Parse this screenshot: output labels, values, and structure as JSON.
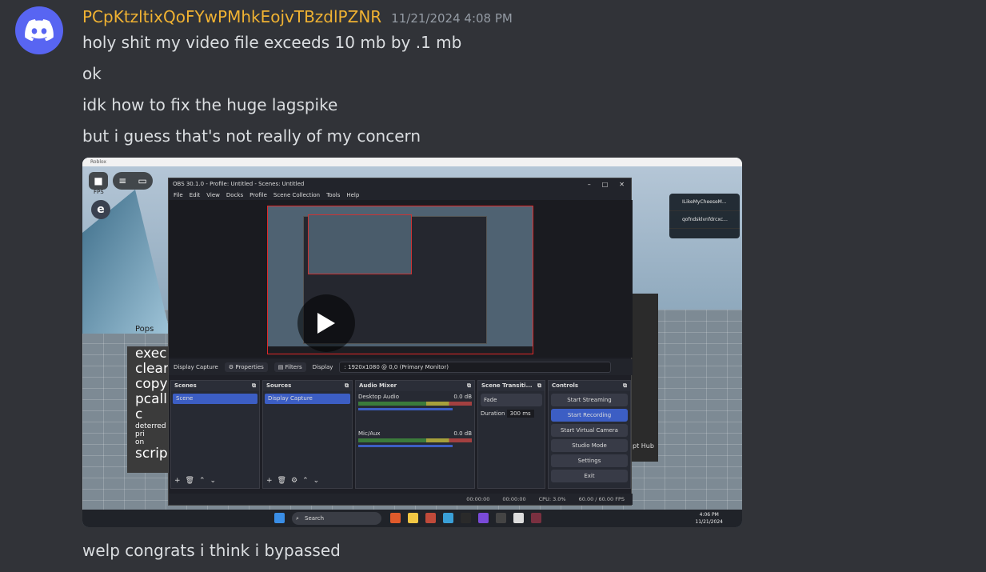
{
  "message": {
    "username": "PCpKtzltixQoFYwPMhkEojvTBzdlPZNR",
    "timestamp": "11/21/2024 4:08 PM",
    "lines": [
      "holy shit my video file exceeds 10 mb by .1 mb",
      "ok",
      "idk how to fix the huge lagspike",
      "but i guess that's not really of my concern"
    ],
    "after_video": "welp congrats i think i bypassed"
  },
  "video": {
    "roblox": {
      "window_title": "Roblox",
      "fps_label": "FPS",
      "pops_label": "Pops",
      "exec_panel": [
        "exec",
        "clear",
        "copy",
        "pcall: c",
        "deterred pri",
        "on",
        "script"
      ],
      "notifications": [
        "ILikeMyCheeseM...",
        "qofndsklvnfdrcxc..."
      ],
      "hub_label": "pt Hub"
    },
    "obs": {
      "title": "OBS 30.1.0 - Profile: Untitled - Scenes: Untitled",
      "menu": [
        "File",
        "Edit",
        "View",
        "Docks",
        "Profile",
        "Scene Collection",
        "Tools",
        "Help"
      ],
      "source_bar": {
        "source": "Display Capture",
        "properties": "Properties",
        "filters": "Filters",
        "display_label": "Display",
        "display_value": ": 1920x1080 @ 0,0 (Primary Monitor)"
      },
      "docks": {
        "scenes": {
          "title": "Scenes",
          "item": "Scene"
        },
        "sources": {
          "title": "Sources",
          "item": "Display Capture"
        },
        "mixer": {
          "title": "Audio Mixer",
          "channels": [
            {
              "name": "Desktop Audio",
              "db": "0.0 dB"
            },
            {
              "name": "Mic/Aux",
              "db": "0.0 dB"
            }
          ]
        },
        "transitions": {
          "title": "Scene Transiti...",
          "type": "Fade",
          "duration_label": "Duration",
          "duration_value": "300 ms"
        },
        "controls": {
          "title": "Controls",
          "buttons": [
            "Start Streaming",
            "Start Recording",
            "Start Virtual Camera",
            "Studio Mode",
            "Settings",
            "Exit"
          ]
        }
      },
      "status": {
        "stream_time": "00:00:00",
        "rec_time": "00:00:00",
        "cpu": "CPU: 3.0%",
        "fps": "60.00 / 60.00 FPS"
      }
    },
    "taskbar": {
      "search_placeholder": "Search",
      "time": "4:06 PM",
      "date": "11/21/2024"
    }
  },
  "colors": {
    "background": "#313338",
    "username": "#f0b232",
    "timestamp": "#949ba4",
    "text": "#dbdee1",
    "blurple": "#5865f2",
    "obs_accent": "#3c5ec4"
  },
  "icons": [
    "discord-icon",
    "play-icon",
    "gear-icon",
    "windows-icon",
    "search-icon"
  ]
}
